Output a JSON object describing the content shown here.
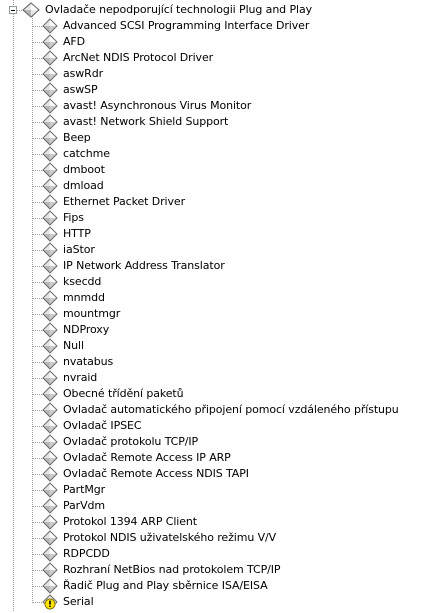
{
  "category": {
    "label": "Ovladače nepodporující technologii Plug and Play",
    "icon": "device-category-icon",
    "expanded": true
  },
  "items": [
    {
      "label": "Advanced SCSI Programming Interface Driver",
      "icon": "device-icon"
    },
    {
      "label": "AFD",
      "icon": "device-icon"
    },
    {
      "label": "ArcNet NDIS Protocol Driver",
      "icon": "device-icon"
    },
    {
      "label": "aswRdr",
      "icon": "device-icon"
    },
    {
      "label": "aswSP",
      "icon": "device-icon"
    },
    {
      "label": "avast! Asynchronous Virus Monitor",
      "icon": "device-icon"
    },
    {
      "label": "avast! Network Shield Support",
      "icon": "device-icon"
    },
    {
      "label": "Beep",
      "icon": "device-icon"
    },
    {
      "label": "catchme",
      "icon": "device-icon"
    },
    {
      "label": "dmboot",
      "icon": "device-icon"
    },
    {
      "label": "dmload",
      "icon": "device-icon"
    },
    {
      "label": "Ethernet Packet Driver",
      "icon": "device-icon"
    },
    {
      "label": "Fips",
      "icon": "device-icon"
    },
    {
      "label": "HTTP",
      "icon": "device-icon"
    },
    {
      "label": "iaStor",
      "icon": "device-icon"
    },
    {
      "label": "IP Network Address Translator",
      "icon": "device-icon"
    },
    {
      "label": "ksecdd",
      "icon": "device-icon"
    },
    {
      "label": "mnmdd",
      "icon": "device-icon"
    },
    {
      "label": "mountmgr",
      "icon": "device-icon"
    },
    {
      "label": "NDProxy",
      "icon": "device-icon"
    },
    {
      "label": "Null",
      "icon": "device-icon"
    },
    {
      "label": "nvatabus",
      "icon": "device-icon"
    },
    {
      "label": "nvraid",
      "icon": "device-icon"
    },
    {
      "label": "Obecné třídění paketů",
      "icon": "device-icon"
    },
    {
      "label": "Ovladač automatického připojení pomocí vzdáleného přístupu",
      "icon": "device-icon"
    },
    {
      "label": "Ovladač IPSEC",
      "icon": "device-icon"
    },
    {
      "label": "Ovladač protokolu TCP/IP",
      "icon": "device-icon"
    },
    {
      "label": "Ovladač Remote Access IP ARP",
      "icon": "device-icon"
    },
    {
      "label": "Ovladač Remote Access NDIS TAPI",
      "icon": "device-icon"
    },
    {
      "label": "PartMgr",
      "icon": "device-icon"
    },
    {
      "label": "ParVdm",
      "icon": "device-icon"
    },
    {
      "label": "Protokol 1394 ARP Client",
      "icon": "device-icon"
    },
    {
      "label": "Protokol NDIS uživatelského režimu V/V",
      "icon": "device-icon"
    },
    {
      "label": "RDPCDD",
      "icon": "device-icon"
    },
    {
      "label": "Rozhraní NetBios nad protokolem TCP/IP",
      "icon": "device-icon"
    },
    {
      "label": "Řadič Plug and Play sběrnice ISA/EISA",
      "icon": "device-icon"
    },
    {
      "label": "Serial",
      "icon": "device-warning-icon"
    }
  ],
  "colors": {
    "icon_light": "#e8e8e8",
    "icon_mid": "#b8b8b8",
    "icon_dark": "#6a6a6a",
    "guide_line": "#a0a0a0",
    "warning_fill": "#ffe600",
    "warning_stroke": "#8a7400"
  }
}
